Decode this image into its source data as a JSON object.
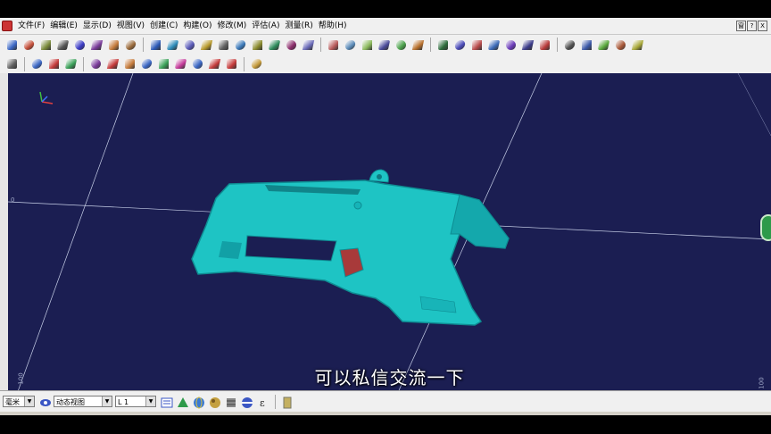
{
  "menu": {
    "items": [
      "文件(F)",
      "编辑(E)",
      "显示(D)",
      "视图(V)",
      "创建(C)",
      "构建(O)",
      "修改(M)",
      "评估(A)",
      "测量(R)",
      "帮助(H)"
    ]
  },
  "window_controls": [
    "窗",
    "?",
    "X"
  ],
  "toolbar1_icons": [
    {
      "name": "import-icon",
      "color": "#3a66c4"
    },
    {
      "name": "export-icon",
      "color": "#c44f3a"
    },
    {
      "name": "open-icon",
      "color": "#7a8a3a"
    },
    {
      "name": "print-icon",
      "color": "#555"
    },
    {
      "name": "layers-icon",
      "color": "#3a3ac4"
    },
    {
      "name": "cube-icon",
      "color": "#7a3a9a"
    },
    {
      "name": "mesh-icon",
      "color": "#c47a3a"
    },
    {
      "name": "surface-icon",
      "color": "#9a6a3a"
    },
    {
      "name": "point-icon",
      "color": "#2c5ab8"
    },
    {
      "name": "curve-icon",
      "color": "#2c8ab8"
    },
    {
      "name": "plane-icon",
      "color": "#5a5ab8"
    },
    {
      "name": "lock-icon",
      "color": "#b89a2c"
    },
    {
      "name": "shape-icon",
      "color": "#606060"
    },
    {
      "name": "body-icon",
      "color": "#3a78b8"
    },
    {
      "name": "chart-icon",
      "color": "#8a8a2c"
    },
    {
      "name": "section-icon",
      "color": "#2c8a5a"
    },
    {
      "name": "patch-icon",
      "color": "#8a2c6a"
    },
    {
      "name": "fill-icon",
      "color": "#6a6ab8"
    },
    {
      "name": "align-icon",
      "color": "#b85a5a"
    },
    {
      "name": "transform-icon",
      "color": "#5a8ab8"
    },
    {
      "name": "scale-icon",
      "color": "#8ab85a"
    },
    {
      "name": "measure-icon",
      "color": "#4a4a9a"
    },
    {
      "name": "check-icon",
      "color": "#4aa04a"
    },
    {
      "name": "deviation-icon",
      "color": "#b8702c"
    },
    {
      "name": "shade-icon",
      "color": "#2c6a3a"
    },
    {
      "name": "render-icon",
      "color": "#4a4ab8"
    },
    {
      "name": "wire-icon",
      "color": "#b84a4a"
    },
    {
      "name": "light-icon",
      "color": "#3a6ab8"
    },
    {
      "name": "reflect-icon",
      "color": "#6a3ab8"
    },
    {
      "name": "hatch-icon",
      "color": "#3a3a8a"
    },
    {
      "name": "zebra-icon",
      "color": "#b83a3a"
    },
    {
      "name": "gauge-icon",
      "color": "#505050"
    },
    {
      "name": "tool1-icon",
      "color": "#3a58a8"
    },
    {
      "name": "tool2-icon",
      "color": "#58a83a"
    },
    {
      "name": "tool3-icon",
      "color": "#a85838"
    },
    {
      "name": "pencil-icon",
      "color": "#a8a838"
    }
  ],
  "toolbar2_icons": [
    {
      "name": "select-icon",
      "color": "#606060"
    },
    {
      "name": "spline-icon",
      "color": "#3a66c4"
    },
    {
      "name": "arrow-icon",
      "color": "#c43a3a"
    },
    {
      "name": "cylinder-icon",
      "color": "#3aa058"
    },
    {
      "name": "grid-icon",
      "color": "#7a3a9a"
    },
    {
      "name": "flash-icon",
      "color": "#c43a3a"
    },
    {
      "name": "hook-icon",
      "color": "#c47a3a"
    },
    {
      "name": "wave-icon",
      "color": "#3a66c4"
    },
    {
      "name": "target-icon",
      "color": "#3aa058"
    },
    {
      "name": "snake-icon",
      "color": "#c43a9a"
    },
    {
      "name": "branch-icon",
      "color": "#3a66c4"
    },
    {
      "name": "cross-icon",
      "color": "#c43a3a"
    },
    {
      "name": "no-icon",
      "color": "#c43a3a"
    },
    {
      "name": "palette-icon",
      "color": "#c49a3a"
    }
  ],
  "viewport": {
    "axis_label_left": "0",
    "axis_label_bottom_left": "100",
    "axis_label_bottom_right": "100",
    "triad_label": "x y z"
  },
  "subtitle": "可以私信交流一下",
  "bottom": {
    "unit": "毫米",
    "view_mode": "动态视图",
    "layer": "L 1",
    "icons": [
      "list-icon",
      "sphere-icon",
      "tree-icon",
      "globe-icon",
      "texture-icon",
      "barrel-icon",
      "epsilon-icon",
      "filter-icon"
    ]
  },
  "colors": {
    "viewport_bg": "#1b1e52",
    "part_color": "#1ec4c4",
    "part_shadow": "#0e8c92"
  }
}
